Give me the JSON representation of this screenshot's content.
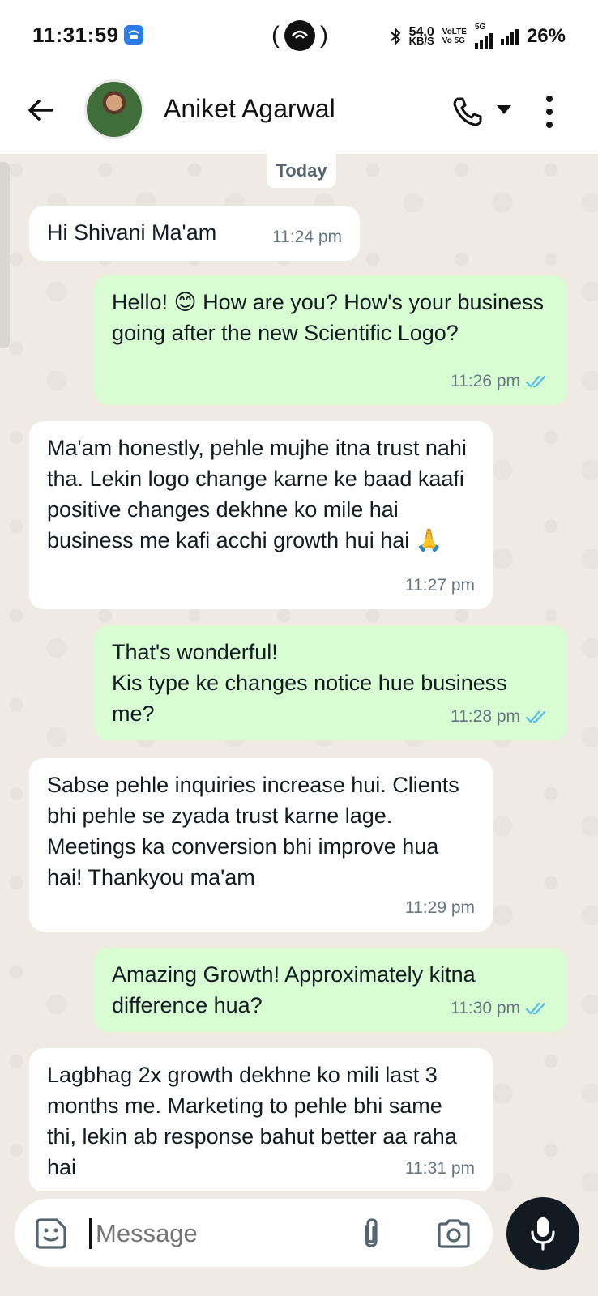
{
  "status_bar": {
    "time": "11:31:59",
    "net_speed": "54.0",
    "net_unit": "KB/S",
    "volte_top": "VoLTE",
    "volte_bottom": "Vo 5G",
    "signal_label": "5G",
    "battery": "26%"
  },
  "header": {
    "contact_name": "Aniket Agarwal",
    "icons": [
      "back-arrow-icon",
      "call-icon",
      "chevron-down-icon",
      "more-vertical-icon"
    ]
  },
  "chat": {
    "date_label": "Today",
    "messages": [
      {
        "direction": "in",
        "text": "Hi Shivani Ma'am",
        "time": "11:24 pm"
      },
      {
        "direction": "out",
        "text": "Hello! 😊 How are you? How's your business going after the new Scientific Logo?",
        "time": "11:26 pm",
        "read": true
      },
      {
        "direction": "in",
        "text": "Ma'am honestly, pehle mujhe itna trust nahi tha. Lekin logo change karne ke baad kaafi positive changes dekhne ko mile hai business me kafi acchi growth hui hai 🙏",
        "time": "11:27 pm"
      },
      {
        "direction": "out",
        "text": "That's wonderful!\nKis type ke changes notice hue business me?",
        "time": "11:28 pm",
        "read": true
      },
      {
        "direction": "in",
        "text": "Sabse pehle inquiries increase hui. Clients bhi pehle se zyada trust karne lage. Meetings ka conversion bhi improve hua hai! Thankyou ma'am",
        "time": "11:29 pm"
      },
      {
        "direction": "out",
        "text": "Amazing Growth!  Approximately kitna difference hua?",
        "time": "11:30 pm",
        "read": true
      },
      {
        "direction": "in",
        "text": "Lagbhag 2x growth dekhne ko mili last 3 months me. Marketing to pehle bhi same thi, lekin ab response bahut better aa raha hai",
        "time": "11:31 pm"
      }
    ]
  },
  "input_bar": {
    "placeholder": "Message",
    "icons": [
      "sticker-icon",
      "attach-icon",
      "camera-icon",
      "mic-icon"
    ]
  },
  "colors": {
    "incoming_bubble": "#ffffff",
    "outgoing_bubble": "#d9fdd3",
    "chat_background": "#efeae2",
    "read_tick": "#53bdeb",
    "mic_button": "#111b21"
  }
}
